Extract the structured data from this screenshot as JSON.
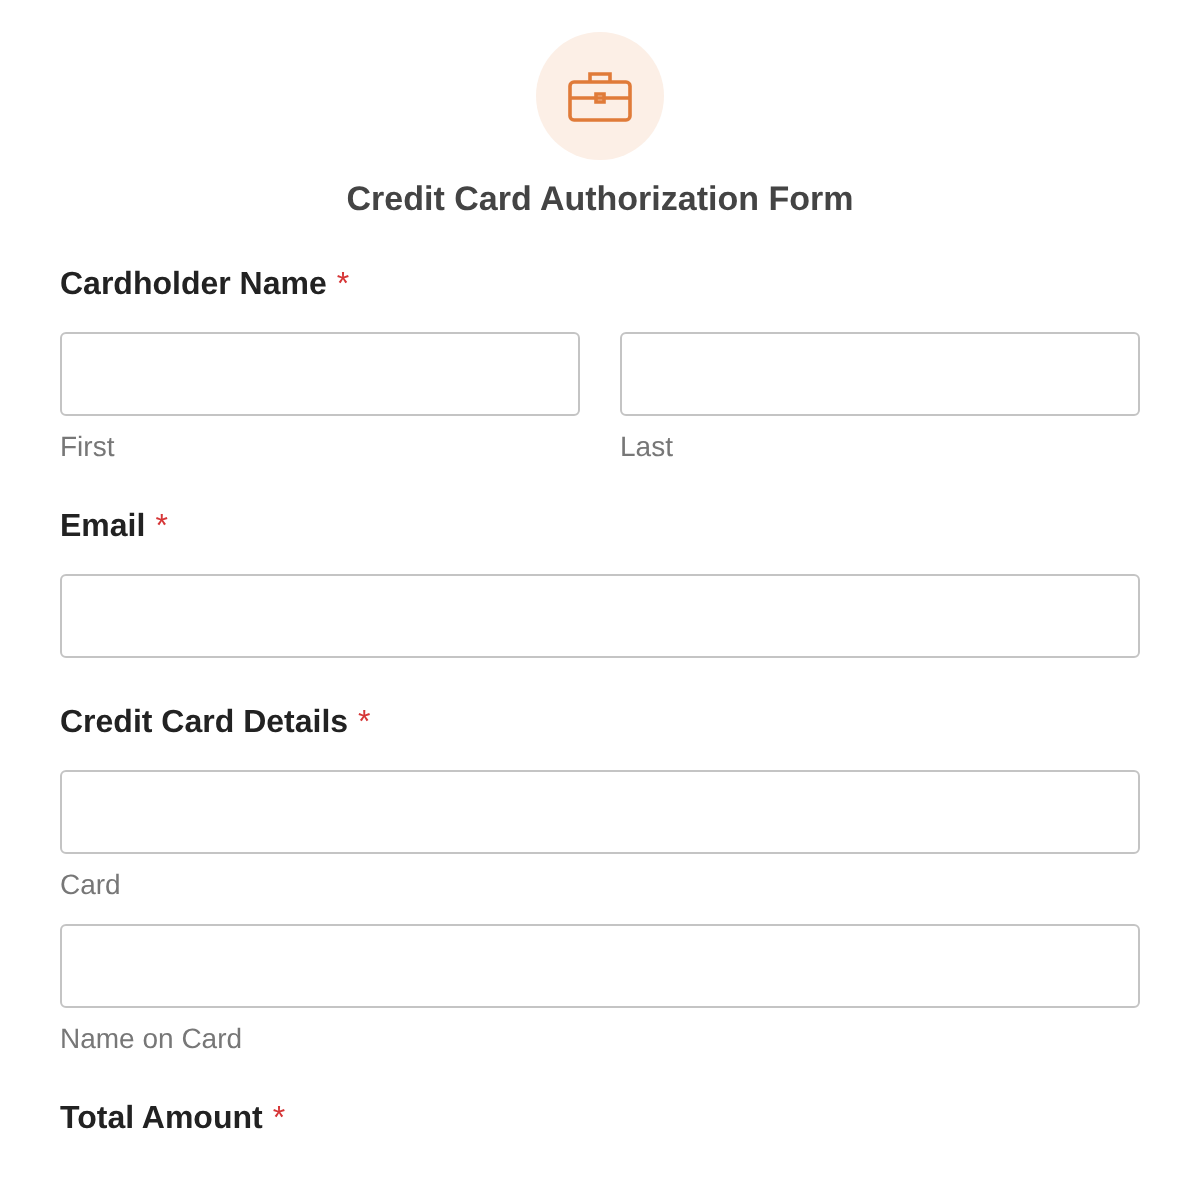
{
  "form": {
    "title": "Credit Card Authorization Form"
  },
  "sections": [
    {
      "label": "Cardholder Name",
      "marker": "*",
      "kind": "pair",
      "fields": [
        {
          "kind": "input",
          "sublabel": "First"
        },
        {
          "kind": "input",
          "sublabel": "Last"
        }
      ]
    },
    {
      "label": "Email",
      "marker": "*",
      "kind": "stack",
      "fields": [
        {
          "kind": "input"
        }
      ]
    },
    {
      "label": "Credit Card Details",
      "marker": "*",
      "kind": "stack",
      "fields": [
        {
          "kind": "input",
          "sublabel": "Card"
        },
        {
          "kind": "input",
          "sublabel": "Name on Card"
        }
      ]
    },
    {
      "label": "Total Amount",
      "marker": "*"
    }
  ]
}
